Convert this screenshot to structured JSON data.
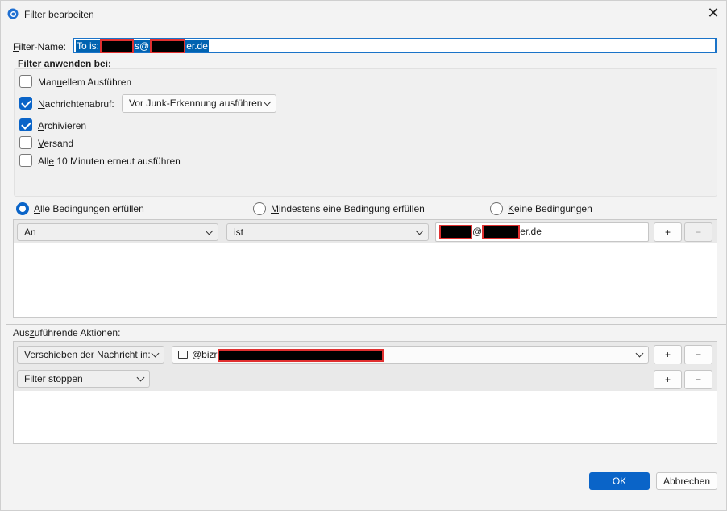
{
  "window": {
    "title": "Filter bearbeiten"
  },
  "filter_name": {
    "label": "Filter-Name:",
    "value_prefix": "To is:",
    "value_mid": "s@",
    "value_suffix": "er.de"
  },
  "apply_group": {
    "title": "Filter anwenden bei:",
    "manual": {
      "label": "Manuellem Ausführen",
      "checked": false
    },
    "fetch": {
      "label": "Nachrichtenabruf:",
      "checked": true,
      "option": "Vor Junk-Erkennung ausführen"
    },
    "archive": {
      "label": "Archivieren",
      "checked": true
    },
    "send": {
      "label": "Versand",
      "checked": false
    },
    "periodic": {
      "label": "Alle 10 Minuten erneut ausführen",
      "checked": false
    }
  },
  "match": {
    "all": "Alle Bedingungen erfüllen",
    "any": "Mindestens eine Bedingung erfüllen",
    "none": "Keine Bedingungen",
    "selected": "all"
  },
  "condition": {
    "field": "An",
    "operator": "ist",
    "value_mid": "@",
    "value_suffix": "er.de",
    "add": "+",
    "remove": "−"
  },
  "actions": {
    "label": "Auszuführende Aktionen:",
    "rows": [
      {
        "action": "Verschieben der Nachricht in:",
        "target_icon": "folder-icon",
        "target_prefix": "@bizr",
        "add": "+",
        "remove": "−"
      },
      {
        "action": "Filter stoppen",
        "add": "+",
        "remove": "−"
      }
    ]
  },
  "footer": {
    "ok": "OK",
    "cancel": "Abbrechen"
  },
  "colors": {
    "accent": "#0a64c8",
    "redaction_border": "#e03030"
  }
}
